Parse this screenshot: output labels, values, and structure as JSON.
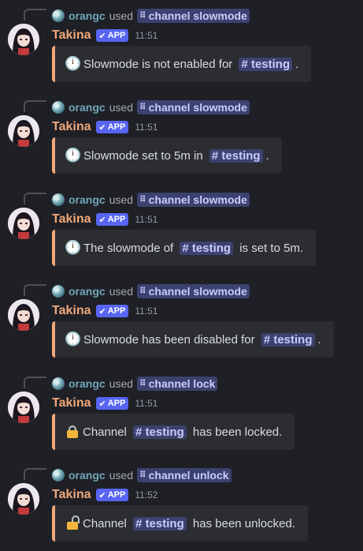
{
  "messages": [
    {
      "ref": {
        "user": "orangc",
        "used": "used",
        "command": "channel slowmode"
      },
      "author": "Takina",
      "badge": "APP",
      "time": "11:51",
      "icon": "clock-icon",
      "parts": [
        "Slowmode is not enabled for ",
        "testing",
        "."
      ]
    },
    {
      "ref": {
        "user": "orangc",
        "used": "used",
        "command": "channel slowmode"
      },
      "author": "Takina",
      "badge": "APP",
      "time": "11:51",
      "icon": "clock-icon",
      "parts": [
        "Slowmode set to 5m in ",
        "testing",
        "."
      ]
    },
    {
      "ref": {
        "user": "orangc",
        "used": "used",
        "command": "channel slowmode"
      },
      "author": "Takina",
      "badge": "APP",
      "time": "11:51",
      "icon": "clock-icon",
      "parts": [
        "The slowmode of ",
        "testing",
        " is set to 5m."
      ]
    },
    {
      "ref": {
        "user": "orangc",
        "used": "used",
        "command": "channel slowmode"
      },
      "author": "Takina",
      "badge": "APP",
      "time": "11:51",
      "icon": "clock-icon",
      "parts": [
        "Slowmode has been disabled for ",
        "testing",
        "."
      ]
    },
    {
      "ref": {
        "user": "orangc",
        "used": "used",
        "command": "channel lock"
      },
      "author": "Takina",
      "badge": "APP",
      "time": "11:51",
      "icon": "lock-icon",
      "parts": [
        "Channel ",
        "testing",
        " has been locked."
      ]
    },
    {
      "ref": {
        "user": "orangc",
        "used": "used",
        "command": "channel unlock"
      },
      "author": "Takina",
      "badge": "APP",
      "time": "11:52",
      "icon": "unlock-icon",
      "parts": [
        "Channel ",
        "testing",
        " has been unlocked."
      ]
    }
  ],
  "channel_prefix": "#",
  "colors": {
    "background": "#1f1f26",
    "embed_bg": "#2b2d31",
    "accent": "#f0a97a",
    "badge": "#5865f2",
    "mention_bg": "#3c4270",
    "mention_fg": "#c9cdfb"
  }
}
